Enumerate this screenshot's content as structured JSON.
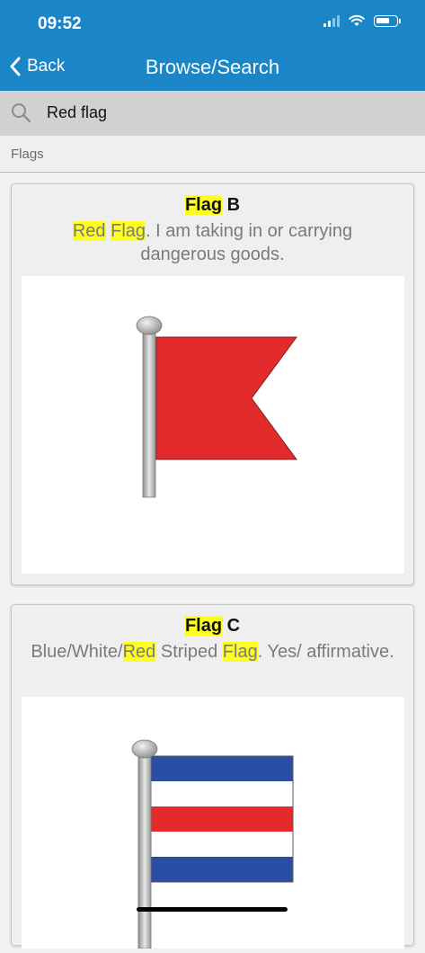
{
  "status": {
    "time": "09:52"
  },
  "nav": {
    "back_label": "Back",
    "title": "Browse/Search"
  },
  "search": {
    "query": "Red flag"
  },
  "section": {
    "label": "Flags"
  },
  "cards": [
    {
      "title_hl": "Flag",
      "title_rest": " B",
      "desc_hl1": "Red",
      "desc_mid": " ",
      "desc_hl2": "Flag",
      "desc_rest": ". I am taking in or carrying dangerous goods."
    },
    {
      "title_hl": "Flag",
      "title_rest": " C",
      "desc_pre": "Blue/White/",
      "desc_hl1": "Red",
      "desc_mid": " Striped ",
      "desc_hl2": "Flag",
      "desc_rest": ". Yes/ affirmative."
    }
  ],
  "colors": {
    "header": "#1a86c8",
    "highlight": "#ffff1f",
    "flag_red": "#e32b2b",
    "flag_blue": "#2a4ea3"
  },
  "icons": [
    "wifi-icon",
    "signal-icon",
    "battery-icon",
    "chevron-left-icon",
    "search-icon"
  ]
}
